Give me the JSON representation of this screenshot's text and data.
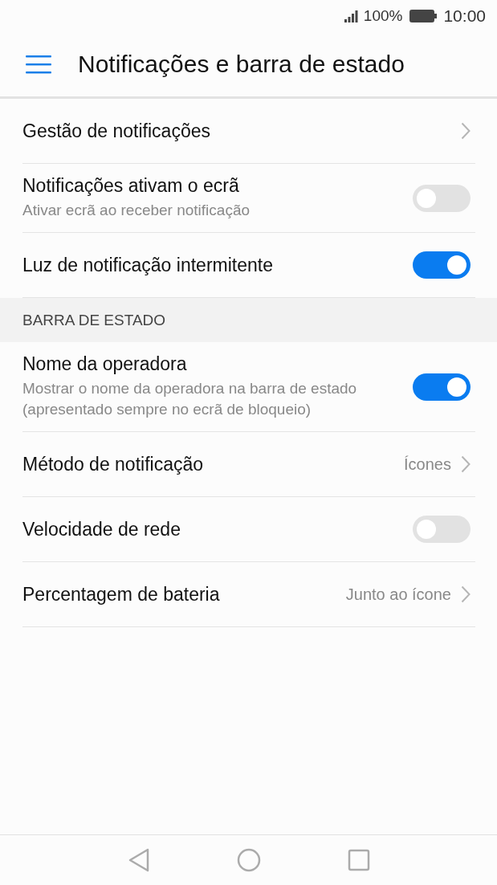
{
  "status_bar": {
    "battery": "100%",
    "time": "10:00"
  },
  "app_bar": {
    "title": "Notificações e barra de estado"
  },
  "sections": [
    {
      "items": [
        {
          "kind": "link",
          "title": "Gestão de notificações"
        },
        {
          "kind": "switch",
          "title": "Notificações ativam o ecrã",
          "subtitle": "Ativar ecrã ao receber notificação",
          "on": false
        },
        {
          "kind": "switch",
          "title": "Luz de notificação intermitente",
          "on": true
        }
      ]
    },
    {
      "header": "BARRA DE ESTADO",
      "items": [
        {
          "kind": "switch",
          "title": "Nome da operadora",
          "subtitle": "Mostrar o nome da operadora na barra de estado (apresentado sempre no ecrã de bloqueio)",
          "on": true
        },
        {
          "kind": "link",
          "title": "Método de notificação",
          "value": "Ícones"
        },
        {
          "kind": "switch",
          "title": "Velocidade de rede",
          "on": false
        },
        {
          "kind": "link",
          "title": "Percentagem de bateria",
          "value": "Junto ao ícone"
        }
      ]
    }
  ]
}
